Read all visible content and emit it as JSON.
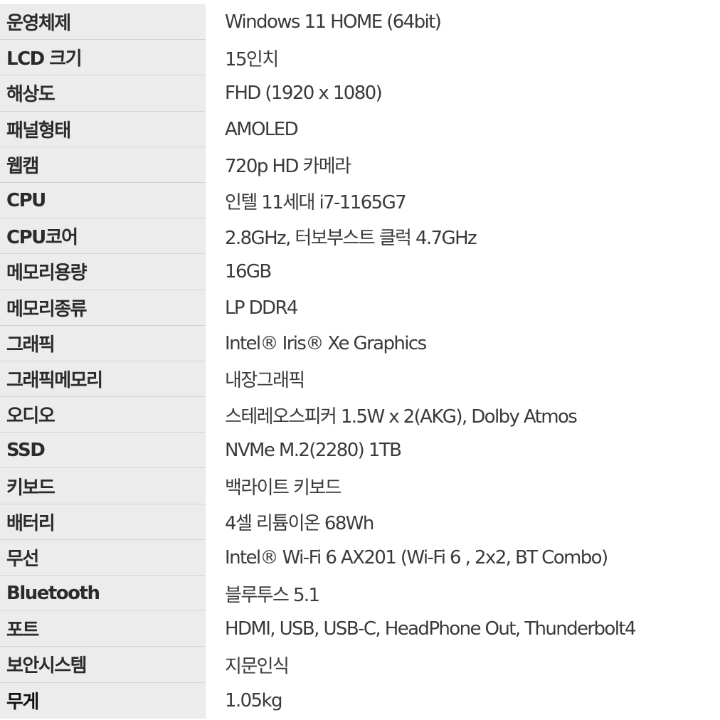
{
  "specs": [
    {
      "label": "운영체제",
      "value": "Windows 11 HOME (64bit)"
    },
    {
      "label": "LCD 크기",
      "value": "15인치"
    },
    {
      "label": "해상도",
      "value": "FHD (1920 x 1080)"
    },
    {
      "label": "패널형태",
      "value": "AMOLED"
    },
    {
      "label": "웹캠",
      "value": "720p HD 카메라"
    },
    {
      "label": "CPU",
      "value": "인텔 11세대 i7-1165G7"
    },
    {
      "label": "CPU코어",
      "value": "2.8GHz, 터보부스트 클럭 4.7GHz"
    },
    {
      "label": "메모리용량",
      "value": "16GB"
    },
    {
      "label": "메모리종류",
      "value": "LP DDR4"
    },
    {
      "label": "그래픽",
      "value": "Intel® Iris® Xe Graphics"
    },
    {
      "label": "그래픽메모리",
      "value": "내장그래픽"
    },
    {
      "label": "오디오",
      "value": "스테레오스피커 1.5W x 2(AKG), Dolby Atmos"
    },
    {
      "label": "SSD",
      "value": "NVMe M.2(2280) 1TB"
    },
    {
      "label": "키보드",
      "value": "백라이트 키보드"
    },
    {
      "label": "배터리",
      "value": "4셀 리튬이온 68Wh"
    },
    {
      "label": "무선",
      "value": "Intel® Wi-Fi 6 AX201 (Wi-Fi 6 , 2x2, BT Combo)"
    },
    {
      "label": "Bluetooth",
      "value": "블루투스 5.1"
    },
    {
      "label": "포트",
      "value": "HDMI, USB, USB-C, HeadPhone Out, Thunderbolt4"
    },
    {
      "label": "보안시스템",
      "value": "지문인식"
    },
    {
      "label": "무게",
      "value": "1.05kg"
    }
  ]
}
